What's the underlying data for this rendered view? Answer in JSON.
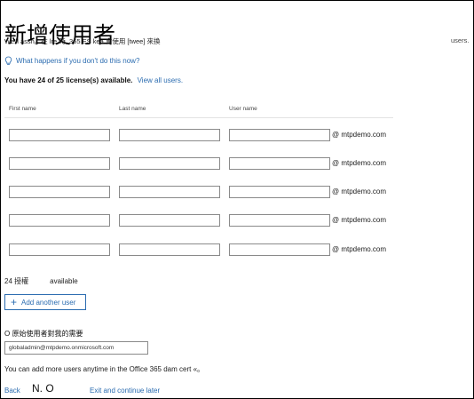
{
  "page": {
    "title": "新增使用者",
    "intro_text": "We'll assn。在 lre 時, 365 ES kea 會使用 [twee] 來換",
    "intro_suffix": "users.",
    "help_link": "What happens if you don't do this now?",
    "license_text": "You have 24 of 25 license(s) available.",
    "license_link": "View all users."
  },
  "table": {
    "headers": {
      "first": "First name",
      "last": "Last name",
      "user": "User name"
    },
    "domain": "@ mtpdemo.com",
    "rows": [
      {
        "first": "",
        "last": "",
        "user": ""
      },
      {
        "first": "",
        "last": "",
        "user": ""
      },
      {
        "first": "",
        "last": "",
        "user": ""
      },
      {
        "first": "",
        "last": "",
        "user": ""
      },
      {
        "first": "",
        "last": "",
        "user": ""
      }
    ]
  },
  "availability": {
    "count": "24 授權",
    "label": "available"
  },
  "add_button": {
    "icon": "plus-icon",
    "label": "Add another user"
  },
  "send_section": {
    "label": "O 原始使用者對我的需要",
    "email_value": "globaladmin@mtpdemo.onmicrosoft.com"
  },
  "footer": {
    "more_text": "You can add more users anytime in the Office 365 dam cert «。",
    "back": "Back",
    "next": "N. O",
    "exit": "Exit and continue later"
  },
  "colors": {
    "link": "#2b6cb0",
    "border": "#8a8a8a"
  }
}
